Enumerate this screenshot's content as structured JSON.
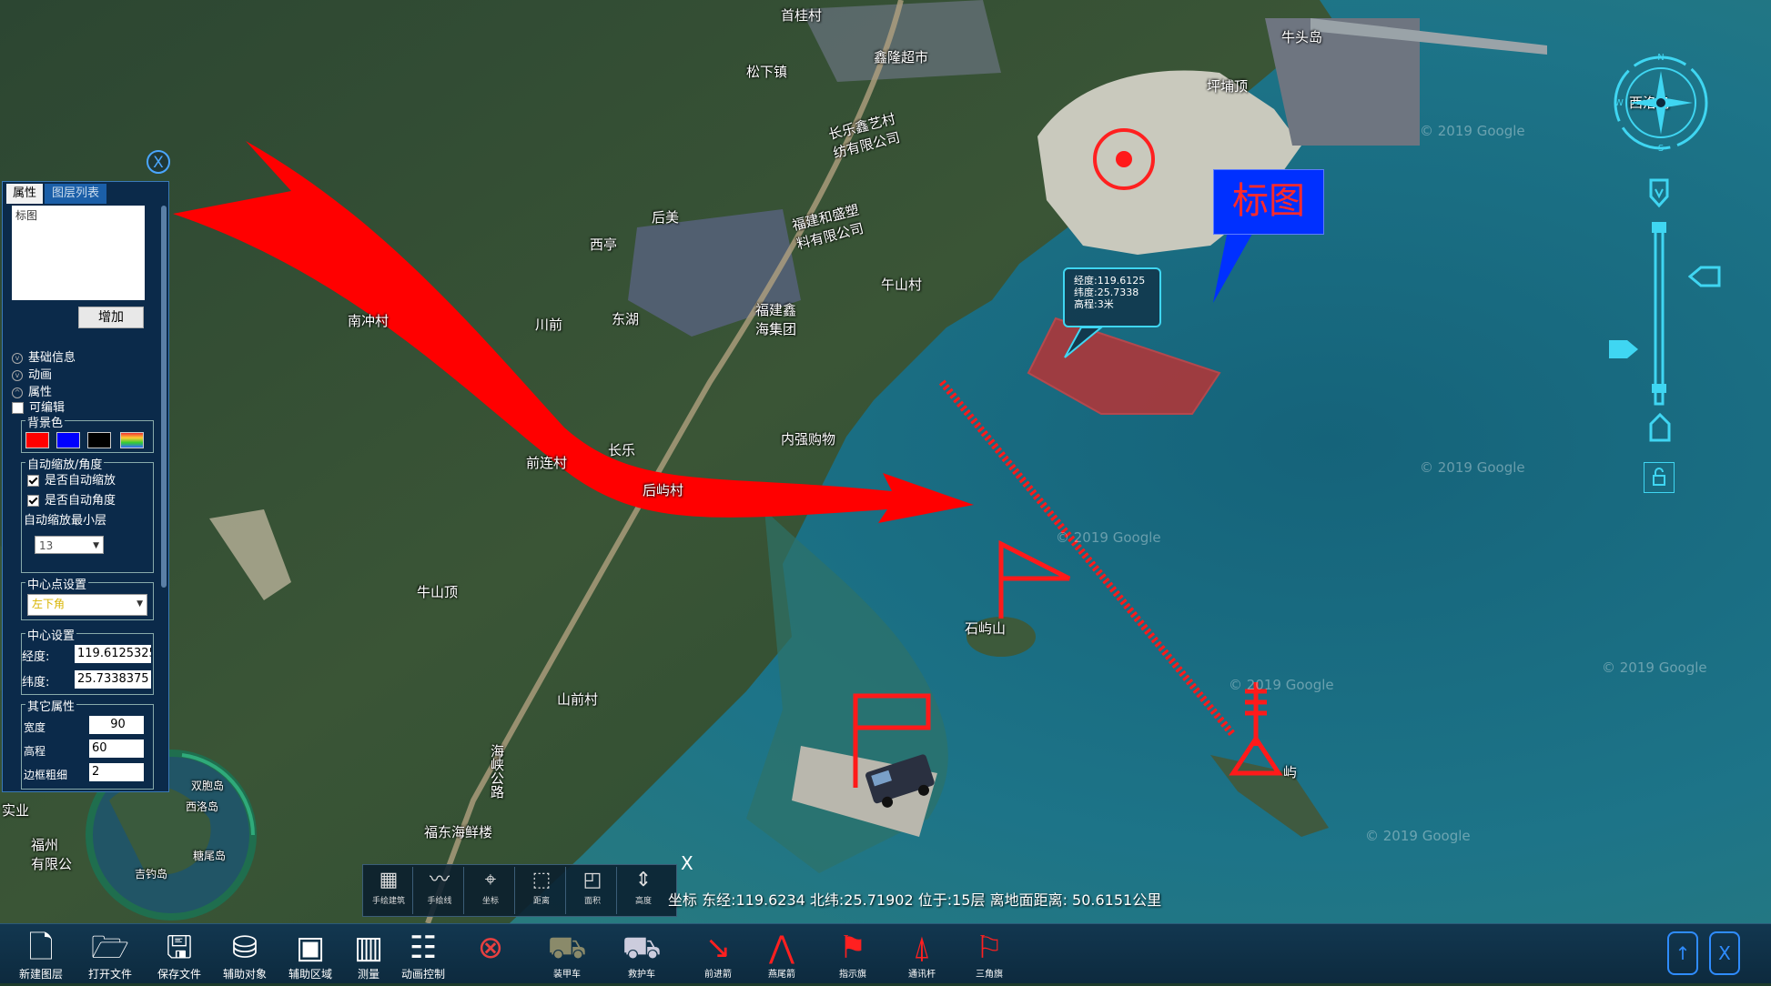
{
  "map": {
    "place_labels": [
      {
        "text": "首桂村"
      },
      {
        "text": "鑫隆超市"
      },
      {
        "text": "松下镇"
      },
      {
        "text": "坪埔顶"
      },
      {
        "text": "长乐鑫艺村\n纺有限公司"
      },
      {
        "text": "后美"
      },
      {
        "text": "西亭"
      },
      {
        "text": "福建和盛塑\n料有限公司"
      },
      {
        "text": "午山村"
      },
      {
        "text": "福建鑫\n海集团"
      },
      {
        "text": "南冲村"
      },
      {
        "text": "川前"
      },
      {
        "text": "东湖"
      },
      {
        "text": "内强购物"
      },
      {
        "text": "长乐"
      },
      {
        "text": "前连村"
      },
      {
        "text": "后屿村"
      },
      {
        "text": "牛山顶"
      },
      {
        "text": "石屿山"
      },
      {
        "text": "山前村"
      },
      {
        "text": "福东海鲜楼"
      },
      {
        "text": "西洛岛"
      },
      {
        "text": "屿"
      },
      {
        "text": "海峡公路"
      },
      {
        "text": "牛头岛"
      },
      {
        "text": "实业"
      },
      {
        "text": "福州\n有限公"
      }
    ],
    "watermarks": [
      "© 2019 Google",
      "© 2019 Google",
      "© 2019 Google",
      "© 2019 Google",
      "© 2019 Google",
      "© 2019 Google"
    ],
    "callout_text": "标图",
    "info_box": {
      "line1": "经度:119.6125",
      "line2": "纬度:25.7338",
      "line3": "高程:3米"
    },
    "overview_labels": [
      "双胞岛",
      "西洛岛",
      "糖尾岛",
      "吉钓岛"
    ],
    "colors": {
      "arrow": "#ff0000",
      "symbol": "#ff1a1a",
      "callout_bg": "#0030ff",
      "polygon": "#c43030",
      "water": "#1a6e7f",
      "accent": "#3fd6f2"
    }
  },
  "panel": {
    "close_label": "X",
    "tabs": {
      "active": "属性",
      "inactive": "图层列表"
    },
    "textarea_value": "标图",
    "add_button": "增加",
    "sections": {
      "basic_info": "基础信息",
      "animation": "动画",
      "attributes": "属性",
      "editable": "可编辑",
      "bg_color": "背景色",
      "auto_zoom_group": "自动缩放/角度",
      "auto_zoom": "是否自动缩放",
      "auto_angle": "是否自动角度",
      "min_zoom_label": "自动缩放最小层",
      "min_zoom_value": "13",
      "center_point_group": "中心点设置",
      "center_point_value": "左下角",
      "center_group": "中心设置",
      "lon_label": "经度:",
      "lon_value": "119.6125325",
      "lat_label": "纬度:",
      "lat_value": "25.7338375",
      "other_group": "其它属性",
      "width_label": "宽度",
      "width_value": "90",
      "height_label": "高程",
      "height_value": "60",
      "border_label": "边框粗细",
      "border_value": "2"
    },
    "swatches": [
      "#ff0000",
      "#0000ff",
      "#000000",
      "rainbow"
    ]
  },
  "draw_toolbar": {
    "tools": [
      {
        "label": "手绘建筑",
        "icon": "building-draw-icon"
      },
      {
        "label": "手绘线",
        "icon": "freehand-line-icon"
      },
      {
        "label": "坐标",
        "icon": "coordinate-icon"
      },
      {
        "label": "距离",
        "icon": "distance-icon"
      },
      {
        "label": "面积",
        "icon": "area-icon"
      },
      {
        "label": "高度",
        "icon": "height-icon"
      }
    ],
    "close_label": "X"
  },
  "status": "坐标 东经:119.6234 北纬:25.71902 位于:15层 离地面距离: 50.6151公里",
  "bottom_toolbar": {
    "tools": [
      {
        "label": "新建图层",
        "icon": "new-layer-icon"
      },
      {
        "label": "打开文件",
        "icon": "open-folder-icon"
      },
      {
        "label": "保存文件",
        "icon": "save-icon"
      },
      {
        "label": "辅助对象",
        "icon": "helper-object-icon"
      },
      {
        "label": "辅助区域",
        "icon": "helper-area-icon"
      },
      {
        "label": "测量",
        "icon": "measure-icon"
      },
      {
        "label": "动画控制",
        "icon": "animation-control-icon"
      }
    ],
    "symbol_labels": [
      "装甲车",
      "救护车",
      "前进箭",
      "燕尾箭",
      "指示旗",
      "通讯杆",
      "三角旗"
    ],
    "right_buttons": [
      "↑",
      "X"
    ]
  }
}
